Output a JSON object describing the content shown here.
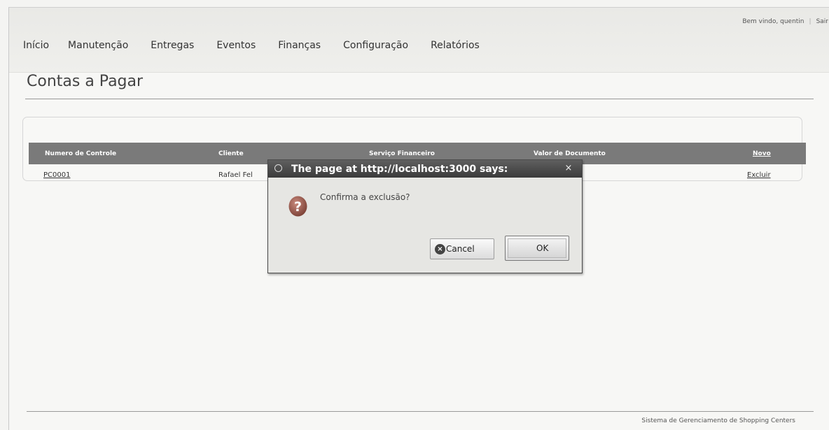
{
  "header": {
    "welcome": "Bem vindo, quentin",
    "logout": "Sair"
  },
  "nav": {
    "items": [
      "Início",
      "Manutenção",
      "Entregas",
      "Eventos",
      "Finanças",
      "Configuração",
      "Relatórios"
    ]
  },
  "page": {
    "title": "Contas a Pagar"
  },
  "table": {
    "columns": [
      "Numero de Controle",
      "Cliente",
      "Serviço Financeiro",
      "Valor de Documento",
      "Novo"
    ],
    "rows": [
      {
        "numero": "PC0001",
        "cliente": "Rafael Fel",
        "action": "Excluir"
      }
    ]
  },
  "dialog": {
    "title": "The page at http://localhost:3000 says:",
    "message": "Confirma a exclusão?",
    "cancel_label": "Cancel",
    "ok_label": "OK"
  },
  "footer": {
    "text": "Sistema de Gerenciamento de Shopping Centers"
  }
}
